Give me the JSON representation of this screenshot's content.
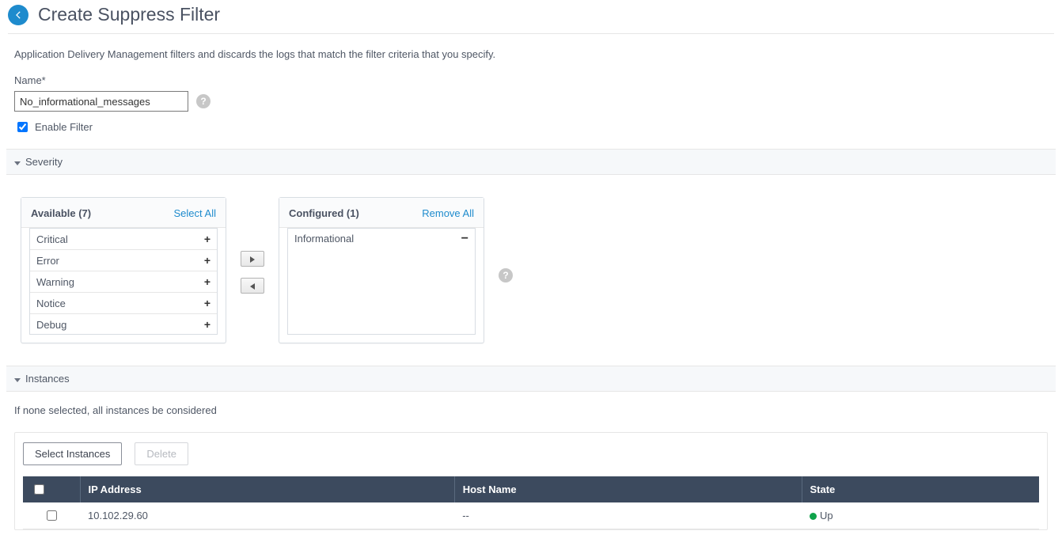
{
  "header": {
    "title": "Create Suppress Filter"
  },
  "description": "Application Delivery Management filters and discards the logs that match the filter criteria that you specify.",
  "nameField": {
    "label": "Name*",
    "value": "No_informational_messages"
  },
  "enableFilter": {
    "label": "Enable Filter",
    "checked": true
  },
  "severity": {
    "title": "Severity",
    "available": {
      "title": "Available (7)",
      "action": "Select All",
      "items": [
        "Critical",
        "Error",
        "Warning",
        "Notice",
        "Debug"
      ]
    },
    "configured": {
      "title": "Configured (1)",
      "action": "Remove All",
      "items": [
        "Informational"
      ]
    }
  },
  "instances": {
    "title": "Instances",
    "note": "If none selected, all instances be considered",
    "buttons": {
      "select": "Select Instances",
      "delete": "Delete"
    },
    "columns": {
      "ip": "IP Address",
      "host": "Host Name",
      "state": "State"
    },
    "rows": [
      {
        "ip": "10.102.29.60",
        "host": "--",
        "state": "Up",
        "stateClass": "up"
      }
    ]
  }
}
